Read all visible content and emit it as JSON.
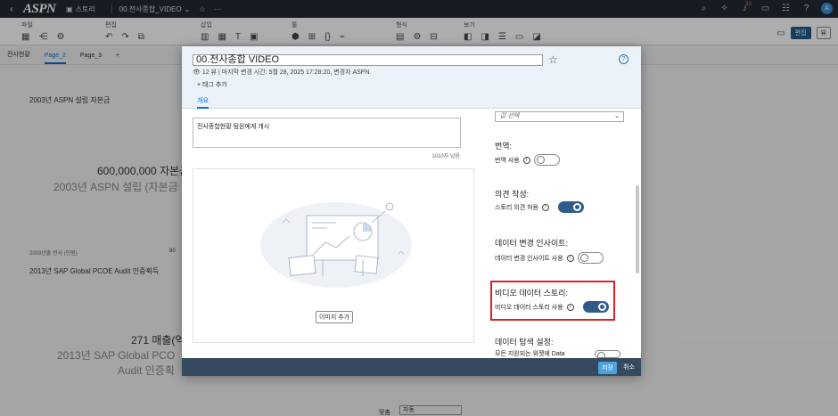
{
  "shell": {
    "logo_text": "ASPN",
    "story_label": "스토리",
    "story_title": "00.전사종합_VIDEO",
    "notification_count": "23",
    "avatar_initial": "A"
  },
  "toolbar": {
    "groups": [
      {
        "label": "파일"
      },
      {
        "label": "편집"
      },
      {
        "label": "삽입"
      },
      {
        "label": "툴"
      },
      {
        "label": "형식"
      },
      {
        "label": "보기"
      }
    ],
    "mode_edit": "편집",
    "mode_view": "뷰"
  },
  "pages": {
    "tabs": [
      "전사현황",
      "Page_2",
      "Page_3"
    ],
    "add_label": "+"
  },
  "background": {
    "heading1": "2003년 ASPN 설립 자본금",
    "big_value1": "600,000,000 자본금",
    "sub_value1": "2003년 ASPN 설립 (자본금",
    "small_label1": "2003년출 전사 (인원)",
    "small_value1": "80",
    "heading2": "2013년 SAP Global PCOE Audit 인증획득",
    "big_value2": "271 매출(억",
    "sub_value2a": "2013년 SAP Global PCO",
    "sub_value2b": "Audit 인증획",
    "footer_label": "맞춤",
    "footer_value": "자동"
  },
  "dialog": {
    "title_value": "00.전사종합  VIDEO",
    "meta": "12 뷰 | 마지막 변경 시간: 5월 28, 2025 17:28:20, 변경자 ASPN",
    "add_tag": "+  태그 추가",
    "tab_overview": "개요",
    "description": "전사종합현황 팀원에게 개시",
    "char_count": "1010자 남음",
    "add_image": "이미지 추가",
    "select_placeholder": "값 선택",
    "sections": [
      {
        "title": "번역:",
        "option": "번역 사용",
        "enabled": false
      },
      {
        "title": "의견 작성:",
        "option": "스토리 의견 허용",
        "enabled": true
      },
      {
        "title": "데이터 변경 인사이트:",
        "option": "데이터 변경 인사이트 사용",
        "enabled": false
      },
      {
        "title": "비디오 데이터 스토리:",
        "option": "비디오 데이터 스토리 사용",
        "enabled": true
      },
      {
        "title": "데이터 탐색 설정:",
        "option": "모든 지원되는 위젯에 Data",
        "enabled": false
      }
    ],
    "save_label": "저장",
    "cancel_label": "취소"
  }
}
